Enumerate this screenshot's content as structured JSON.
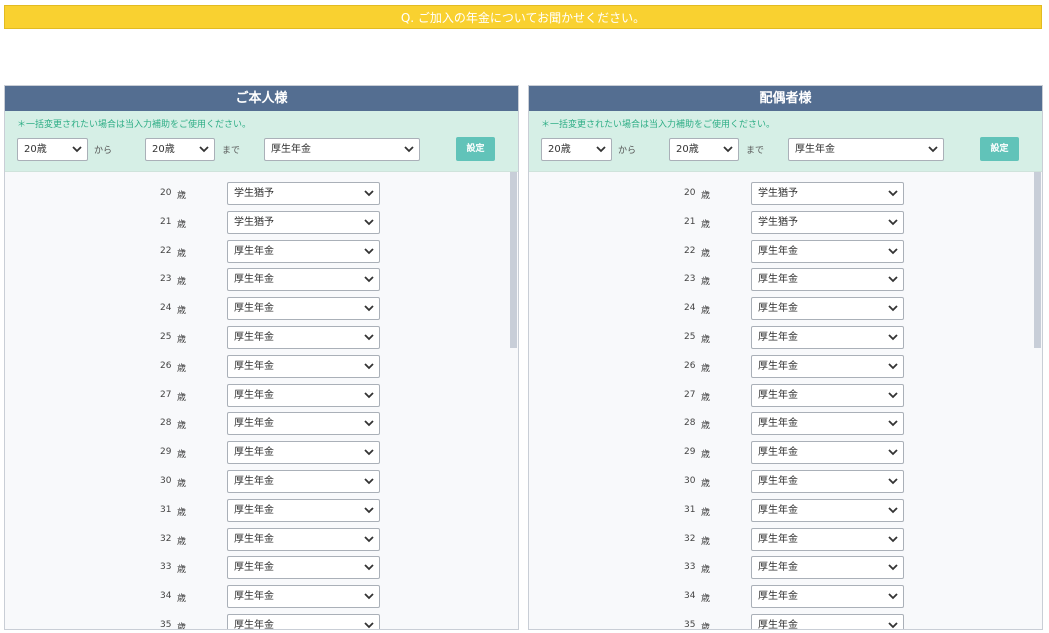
{
  "question": "Q. ご加入の年金についてお聞かせください。",
  "panels": [
    {
      "title": "ご本人様",
      "helper": {
        "note": "＊一括変更されたい場合は当入力補助をご使用ください。",
        "from_value": "20歳",
        "from_word": "から",
        "to_value": "20歳",
        "to_word": "まで",
        "type_value": "厚生年金",
        "set_label": "設定"
      }
    },
    {
      "title": "配偶者様",
      "helper": {
        "note": "＊一括変更されたい場合は当入力補助をご使用ください。",
        "from_value": "20歳",
        "from_word": "から",
        "to_value": "20歳",
        "to_word": "まで",
        "type_value": "厚生年金",
        "set_label": "設定"
      }
    }
  ],
  "age_unit": "歳",
  "rows": [
    {
      "age": "20",
      "value": "学生猶予"
    },
    {
      "age": "21",
      "value": "学生猶予"
    },
    {
      "age": "22",
      "value": "厚生年金"
    },
    {
      "age": "23",
      "value": "厚生年金"
    },
    {
      "age": "24",
      "value": "厚生年金"
    },
    {
      "age": "25",
      "value": "厚生年金"
    },
    {
      "age": "26",
      "value": "厚生年金"
    },
    {
      "age": "27",
      "value": "厚生年金"
    },
    {
      "age": "28",
      "value": "厚生年金"
    },
    {
      "age": "29",
      "value": "厚生年金"
    },
    {
      "age": "30",
      "value": "厚生年金"
    },
    {
      "age": "31",
      "value": "厚生年金"
    },
    {
      "age": "32",
      "value": "厚生年金"
    },
    {
      "age": "33",
      "value": "厚生年金"
    },
    {
      "age": "34",
      "value": "厚生年金"
    },
    {
      "age": "35",
      "value": "厚生年金"
    }
  ],
  "colors": {
    "question_bar": "#f9d130",
    "panel_header": "#546e91",
    "helper_bg": "#d6efe6",
    "helper_note": "#2fae86",
    "set_button": "#61c3b9"
  },
  "icons": {
    "dropdown": "chevron-down-icon"
  }
}
